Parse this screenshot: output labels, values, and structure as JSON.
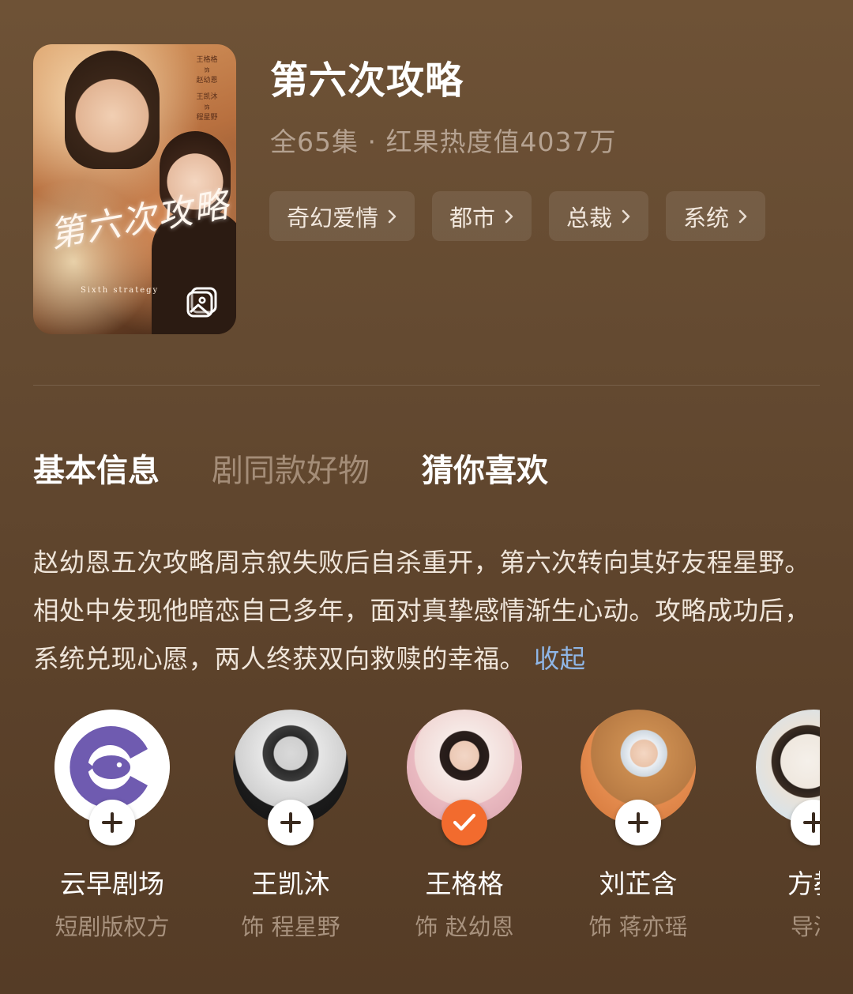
{
  "drama": {
    "title": "第六次攻略",
    "meta": "全65集 · 红果热度值4037万",
    "poster": {
      "credits": [
        "王格格",
        "饰",
        "赵幼恩",
        "王凯沐",
        "饰",
        "程星野"
      ],
      "title_art": "第六次攻略",
      "subtitle_art": "Sixth strategy",
      "icon": "gallery-icon"
    },
    "tags": [
      {
        "label": "奇幻爱情"
      },
      {
        "label": "都市"
      },
      {
        "label": "总裁"
      },
      {
        "label": "系统"
      }
    ]
  },
  "tabs": [
    {
      "label": "基本信息",
      "active": true
    },
    {
      "label": "剧同款好物",
      "active": false
    },
    {
      "label": "猜你喜欢",
      "active": true
    }
  ],
  "synopsis": {
    "text": "赵幼恩五次攻略周京叙失败后自杀重开，第六次转向其好友程星野。相处中发现他暗恋自己多年，面对真挚感情渐生心动。攻略成功后，系统兑现心愿，两人终获双向救赎的幸福。",
    "collapse_label": "收起"
  },
  "cast": [
    {
      "name": "云早剧场",
      "role": "短剧版权方",
      "followed": false,
      "avatar": "fish-logo-icon"
    },
    {
      "name": "王凯沐",
      "role": "饰 程星野",
      "followed": false,
      "avatar": "photo"
    },
    {
      "name": "王格格",
      "role": "饰 赵幼恩",
      "followed": true,
      "avatar": "photo"
    },
    {
      "name": "刘芷含",
      "role": "饰 蒋亦瑶",
      "followed": false,
      "avatar": "photo"
    },
    {
      "name": "方教",
      "role": "导演",
      "followed": false,
      "avatar": "photo"
    }
  ],
  "colors": {
    "background": "#644a31",
    "followed_badge": "#f26b2e",
    "link": "#8fb6e6",
    "fish_logo": "#6f5bb0"
  }
}
